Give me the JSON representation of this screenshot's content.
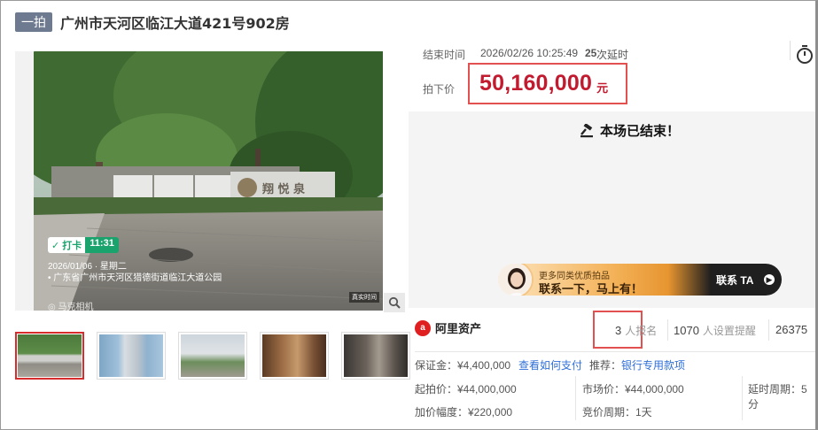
{
  "header": {
    "round": "一拍",
    "title": "广州市天河区临江大道421号902房"
  },
  "photo": {
    "checkin_label": "打卡",
    "checkin_time": "11:31",
    "date": "2026/01/06 · 星期二",
    "location": "广东省广州市天河区猎德街道临江大道公园",
    "watermark": "马克相机",
    "real_time": "真实时间"
  },
  "auction": {
    "end_label": "结束时间",
    "end_time": "2026/02/26 10:25:49",
    "delay_count": "25",
    "delay_label": "次延时",
    "price_label": "拍下价",
    "price": "50,160,000",
    "price_unit": "元",
    "ended_text": "本场已结束！"
  },
  "promo": {
    "small": "更多同类优质拍品",
    "big": "联系一下，马上有！",
    "cta": "联系 TA"
  },
  "brand": {
    "name": "阿里资产"
  },
  "stats": {
    "signups": "3",
    "signups_label": "人报名",
    "reminders": "1070",
    "reminders_label": "人设置提醒",
    "views": "26375"
  },
  "details": {
    "deposit": "保证金：¥4,400,000",
    "deposit_link": "查看如何支付",
    "recommend": "推荐：",
    "recommend_link": "银行专用款项",
    "start_price": "起拍价：¥44,000,000",
    "market_price": "市场价：¥44,000,000",
    "delay_period": "延时周期：5分",
    "increment": "加价幅度：¥220,000",
    "bid_period": "竞价周期：1天"
  },
  "colors": {
    "price": "#c21a2f",
    "highlight_border": "#e35050",
    "badge": "#6d7a8f",
    "link": "#2f6fd6"
  }
}
